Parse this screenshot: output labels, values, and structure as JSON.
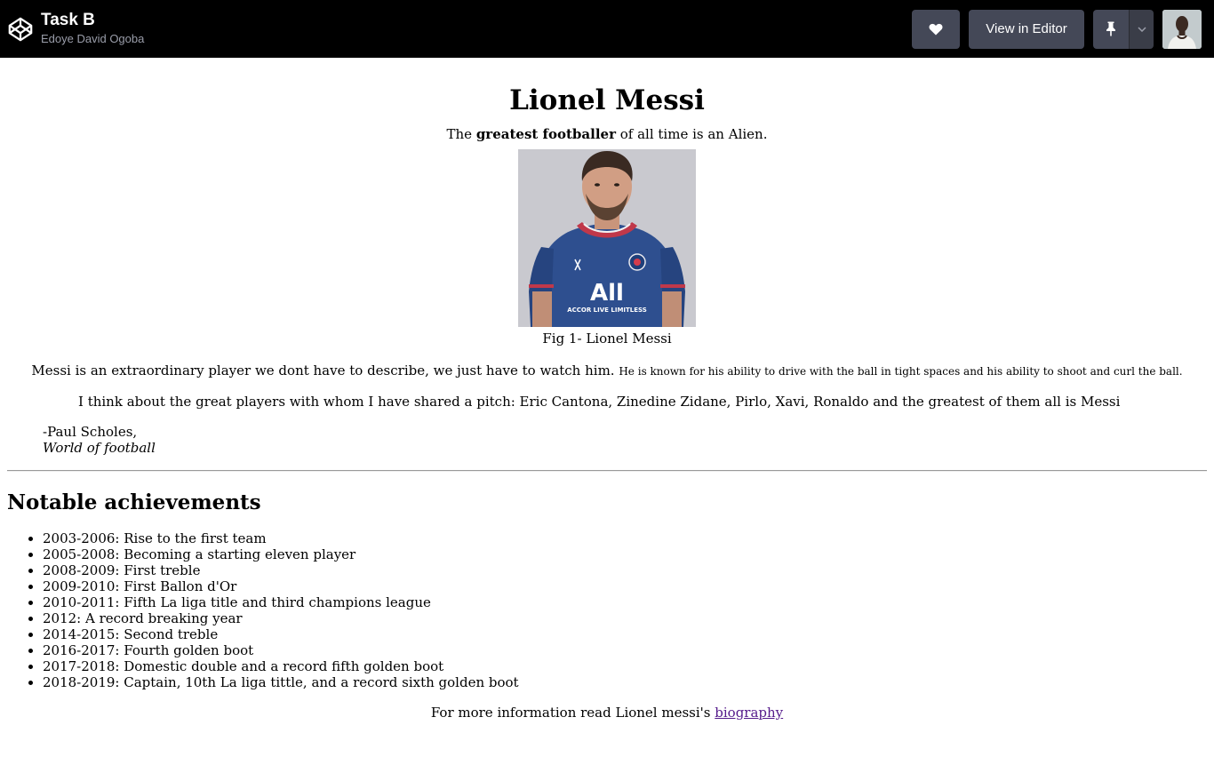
{
  "header": {
    "title": "Task B",
    "author": "Edoye David Ogoba",
    "like_icon": "heart-icon",
    "view_in_editor": "View in Editor",
    "pin_icon": "pin-icon",
    "caret_icon": "chevron-down-icon",
    "logo_icon": "codepen-logo-icon",
    "accent": "#444857"
  },
  "page": {
    "title": "Lionel Messi",
    "tagline": {
      "before": "The ",
      "bold": "greatest footballer",
      "after": " of all time is an Alien."
    },
    "image": {
      "jersey_text": "All",
      "jersey_sub": "ACCOR LIVE LIMITLESS"
    },
    "caption": "Fig 1- Lionel Messi",
    "description": {
      "main": "Messi is an extraordinary player we dont have to describe, we just have to watch him.",
      "small": "He is known for his ability to drive with the ball in tight spaces and his ability to shoot and curl the ball."
    },
    "quote": {
      "text": "I think about the great players with whom I have shared a pitch: Eric Cantona, Zinedine Zidane, Pirlo, Xavi, Ronaldo and the greatest of them all is Messi",
      "author": "-Paul Scholes,",
      "source": "World of football"
    },
    "achievements_heading": "Notable achievements",
    "achievements": [
      "2003-2006: Rise to the first team",
      "2005-2008: Becoming a starting eleven player",
      "2008-2009: First treble",
      "2009-2010: First Ballon d'Or",
      "2010-2011: Fifth La liga title and third champions league",
      "2012: A record breaking year",
      "2014-2015: Second treble",
      "2016-2017: Fourth golden boot",
      "2017-2018: Domestic double and a record fifth golden boot",
      "2018-2019: Captain, 10th La liga tittle, and a record sixth golden boot"
    ],
    "more_info": {
      "text": "For more information read Lionel messi's ",
      "link": "biography"
    }
  }
}
